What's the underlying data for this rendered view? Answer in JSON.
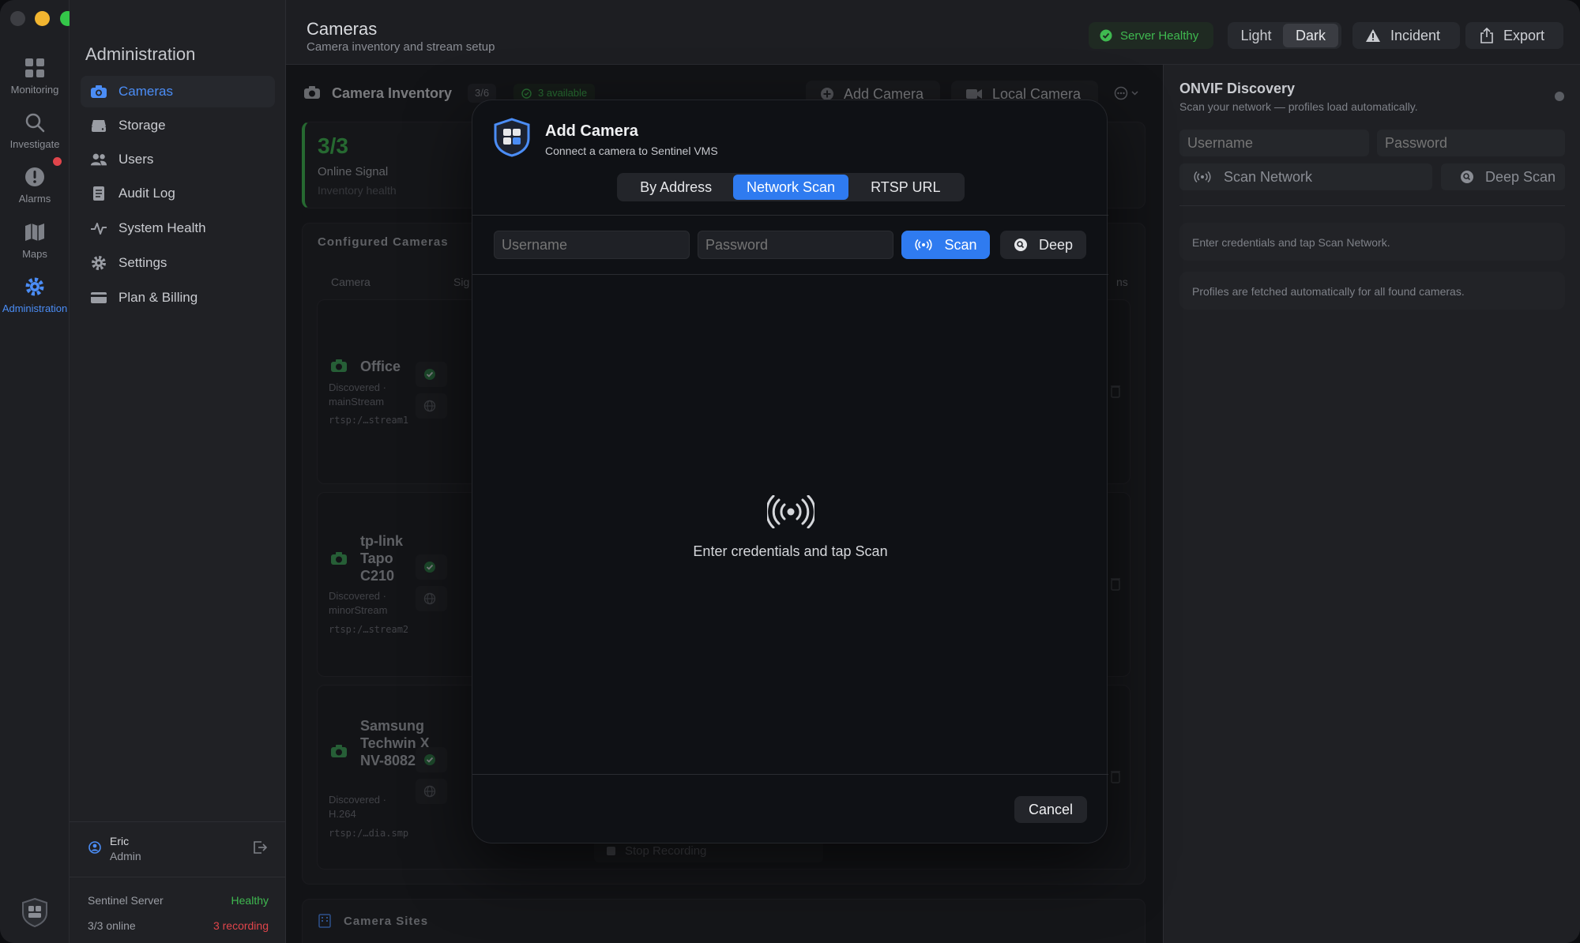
{
  "window": {
    "traffic_colors": [
      "#3d3e43",
      "#f2b530",
      "#34c749"
    ]
  },
  "rail": {
    "items": [
      {
        "label": "Monitoring",
        "icon": "grid-icon"
      },
      {
        "label": "Investigate",
        "icon": "search-icon"
      },
      {
        "label": "Alarms",
        "icon": "alert-icon"
      },
      {
        "label": "Maps",
        "icon": "map-icon"
      },
      {
        "label": "Administration",
        "icon": "gear-icon",
        "active": true
      }
    ]
  },
  "sidebar": {
    "title": "Administration",
    "items": [
      {
        "label": "Cameras",
        "icon": "camera-icon",
        "active": true
      },
      {
        "label": "Storage",
        "icon": "storage-icon"
      },
      {
        "label": "Users",
        "icon": "users-icon"
      },
      {
        "label": "Audit Log",
        "icon": "document-icon"
      },
      {
        "label": "System Health",
        "icon": "pulse-icon"
      },
      {
        "label": "Settings",
        "icon": "gear-icon"
      },
      {
        "label": "Plan & Billing",
        "icon": "card-icon"
      }
    ],
    "user": {
      "name": "Eric",
      "role": "Admin"
    },
    "server": {
      "name": "Sentinel Server",
      "health": "Healthy",
      "online": "3/3 online",
      "recording": "3 recording"
    }
  },
  "header": {
    "title": "Cameras",
    "subtitle": "Camera inventory and stream setup",
    "server_status": "Server Healthy",
    "theme_light": "Light",
    "theme_dark": "Dark",
    "incident": "Incident",
    "export": "Export"
  },
  "inventory": {
    "title": "Camera Inventory",
    "count": "3/6",
    "available": "3 available",
    "add_camera": "Add Camera",
    "local_camera": "Local Camera",
    "summary_value": "3/3",
    "summary_label": "Online Signal",
    "summary_sub": "Inventory health",
    "configured_title": "Configured Cameras",
    "col_camera": "Camera",
    "col_signal": "Sig",
    "col_actions": "ns",
    "stop_recording": "Stop Recording",
    "sites_title": "Camera Sites",
    "cameras": [
      {
        "name": "Office",
        "meta": "Discovered · mainStream",
        "url": "rtsp:/…stream1"
      },
      {
        "name": "tp-link Tapo C210",
        "meta": "Discovered · minorStream",
        "url": "rtsp:/…stream2"
      },
      {
        "name": "Samsung Techwin XNV-8082R",
        "meta": "Discovered · H.264",
        "url": "rtsp:/…dia.smp"
      }
    ]
  },
  "onvif": {
    "title": "ONVIF Discovery",
    "subtitle": "Scan your network — profiles load automatically.",
    "username_placeholder": "Username",
    "password_placeholder": "Password",
    "scan_network": "Scan Network",
    "deep_scan": "Deep Scan",
    "hint1": "Enter credentials and tap Scan Network.",
    "hint2": "Profiles are fetched automatically for all found cameras."
  },
  "modal": {
    "title": "Add Camera",
    "subtitle": "Connect a camera to Sentinel VMS",
    "tabs": [
      "By Address",
      "Network Scan",
      "RTSP URL"
    ],
    "selected_tab": "Network Scan",
    "username_placeholder": "Username",
    "password_placeholder": "Password",
    "scan": "Scan",
    "deep": "Deep",
    "empty_text": "Enter credentials and tap Scan",
    "cancel": "Cancel"
  },
  "colors": {
    "accent": "#2f7bf0",
    "success": "#3fb950",
    "danger": "#e0454b"
  }
}
